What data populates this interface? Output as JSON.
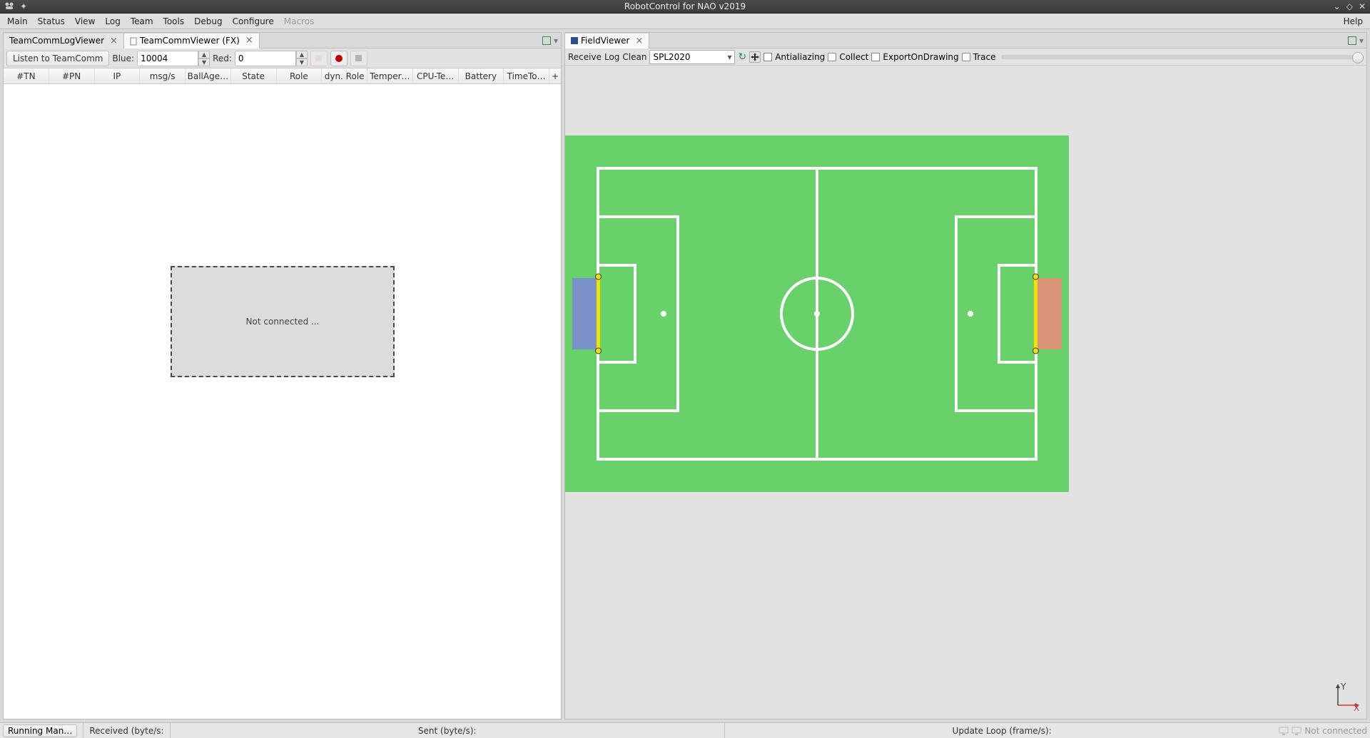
{
  "window": {
    "title": "RobotControl for NAO v2019"
  },
  "menu": {
    "main": "Main",
    "status": "Status",
    "view": "View",
    "log": "Log",
    "team": "Team",
    "tools": "Tools",
    "debug": "Debug",
    "configure": "Configure",
    "macros": "Macros",
    "help": "Help"
  },
  "left_tabs": {
    "t0": {
      "label": "TeamCommLogViewer"
    },
    "t1": {
      "label": "TeamCommViewer (FX)"
    }
  },
  "toolbar": {
    "listen": "Listen to TeamComm",
    "blue_label": "Blue:",
    "blue_port": "10004",
    "red_label": "Red:",
    "red_port": "0"
  },
  "columns": {
    "c0": "#TN",
    "c1": "#PN",
    "c2": "IP",
    "c3": "msg/s",
    "c4": "BallAge…",
    "c5": "State",
    "c6": "Role",
    "c7": "dyn. Role",
    "c8": "Temper…",
    "c9": "CPU-Te…",
    "c10": "Battery",
    "c11": "TimeTo…",
    "c12": "+"
  },
  "empty_text": "Not connected ...",
  "field_tab": {
    "label": "FieldViewer"
  },
  "fv_toolbar": {
    "receive": "Receive",
    "log": "Log",
    "clean": "Clean",
    "dropdown_value": "SPL2020",
    "antialiazing": "Antialiazing",
    "collect": "Collect",
    "export": "ExportOnDrawing",
    "trace": "Trace"
  },
  "axis": {
    "x": "X",
    "y": "Y"
  },
  "status": {
    "running": "Running Man…",
    "received": "Received (byte/s:",
    "sent": "Sent (byte/s):",
    "update": "Update Loop (frame/s):",
    "not_connected": "Not connected"
  },
  "colors": {
    "field_green": "#69d169",
    "line_white": "#ffffff",
    "goal_blue": "#7a92c9",
    "goal_orange": "#d99477",
    "post_yellow": "#f5e100"
  }
}
